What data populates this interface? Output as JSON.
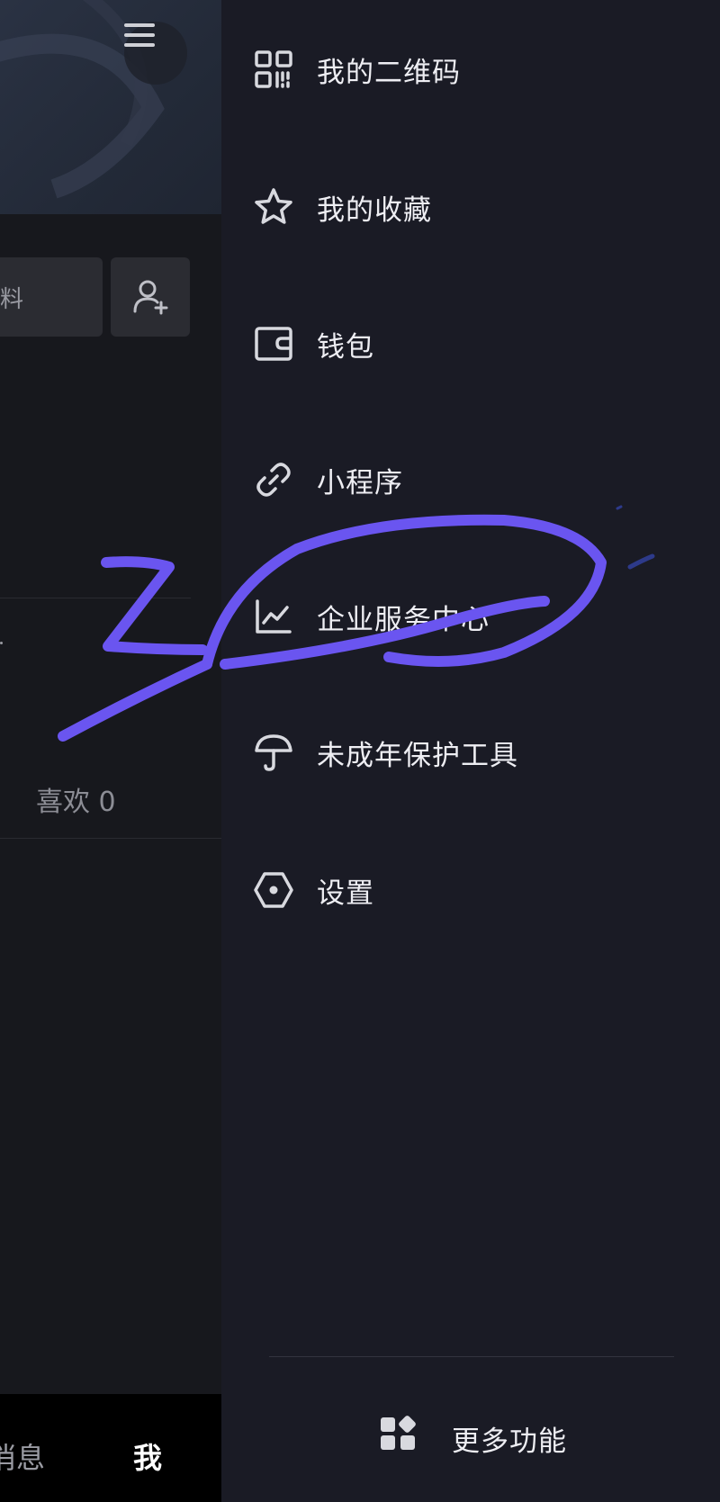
{
  "profile": {
    "edit_label": "料",
    "likes_label": "喜欢 0"
  },
  "bottom_nav": {
    "messages": "消息",
    "me": "我"
  },
  "drawer": {
    "items": [
      {
        "label": "我的二维码",
        "icon": "qr-code-icon"
      },
      {
        "label": "我的收藏",
        "icon": "star-icon"
      },
      {
        "label": "钱包",
        "icon": "wallet-icon"
      },
      {
        "label": "小程序",
        "icon": "link-icon"
      },
      {
        "label": "企业服务中心",
        "icon": "line-chart-icon"
      },
      {
        "label": "未成年保护工具",
        "icon": "umbrella-icon"
      },
      {
        "label": "设置",
        "icon": "hexagon-settings-icon"
      }
    ],
    "more": {
      "label": "更多功能",
      "icon": "apps-grid-icon"
    }
  },
  "colors": {
    "drawer_bg": "#1a1b25",
    "page_bg": "#141519",
    "annotation": "#6a55f0"
  }
}
